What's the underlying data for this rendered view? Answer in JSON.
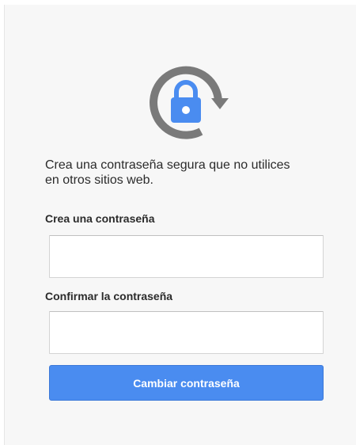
{
  "header": {
    "icon": "lock-refresh-icon",
    "colors": {
      "ring": "#7a7a7a",
      "lock": "#4a8cf0"
    }
  },
  "intro_text": "Crea una contraseña segura que no utilices en otros sitios web.",
  "form": {
    "new_password_label": "Crea una contraseña",
    "new_password_value": "",
    "confirm_password_label": "Confirmar la contraseña",
    "confirm_password_value": "",
    "submit_label": "Cambiar contraseña"
  },
  "colors": {
    "accent": "#4a8cf0",
    "text": "#2b2b2b",
    "background": "#f7f7f7"
  }
}
